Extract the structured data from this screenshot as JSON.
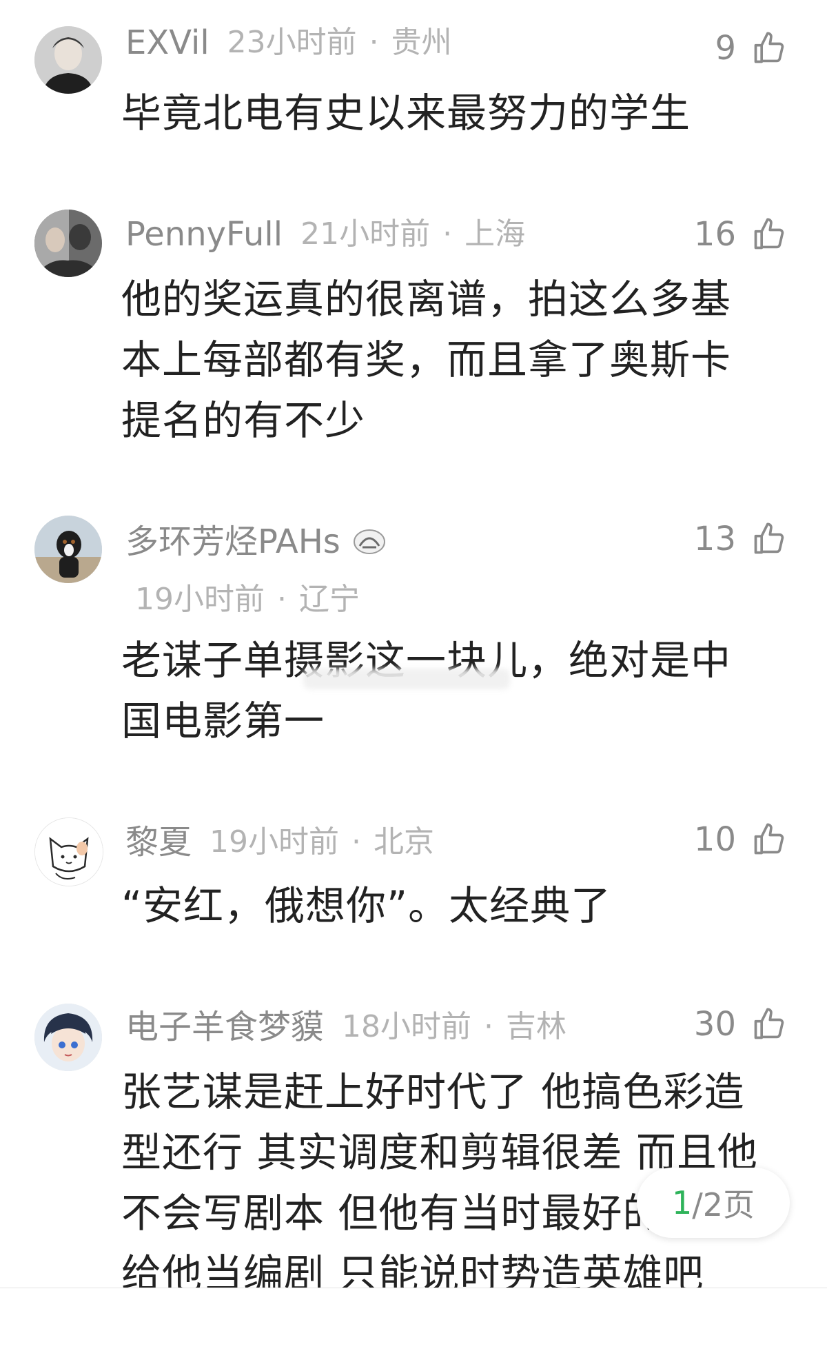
{
  "comments": [
    {
      "username": "EXVil",
      "time": "23小时前",
      "location": "贵州",
      "likes": "9",
      "text": "毕竟北电有史以来最努力的学生"
    },
    {
      "username": "PennyFull",
      "time": "21小时前",
      "location": "上海",
      "likes": "16",
      "text": "他的奖运真的很离谱，拍这么多基本上每部都有奖，而且拿了奥斯卡提名的有不少"
    },
    {
      "username": "多环芳烃PAHs",
      "time": "19小时前",
      "location": "辽宁",
      "likes": "13",
      "text": "老谋子单摄影这一块儿，绝对是中国电影第一"
    },
    {
      "username": "黎夏",
      "time": "19小时前",
      "location": "北京",
      "likes": "10",
      "text": "“安红，俄想你”。太经典了"
    },
    {
      "username": "电子羊食梦貘",
      "time": "18小时前",
      "location": "吉林",
      "likes": "30",
      "text": "张艺谋是赶上好时代了 他搞色彩造型还行 其实调度和剪辑很差 而且他不会写剧本 但他有当时最好的作家给他当编剧 只能说时势造英雄吧"
    }
  ],
  "separator": "·",
  "pager": {
    "current": "1",
    "rest": "/2页"
  },
  "icons": {
    "like": "thumbs-up-icon",
    "badge": "fan-badge-icon"
  }
}
